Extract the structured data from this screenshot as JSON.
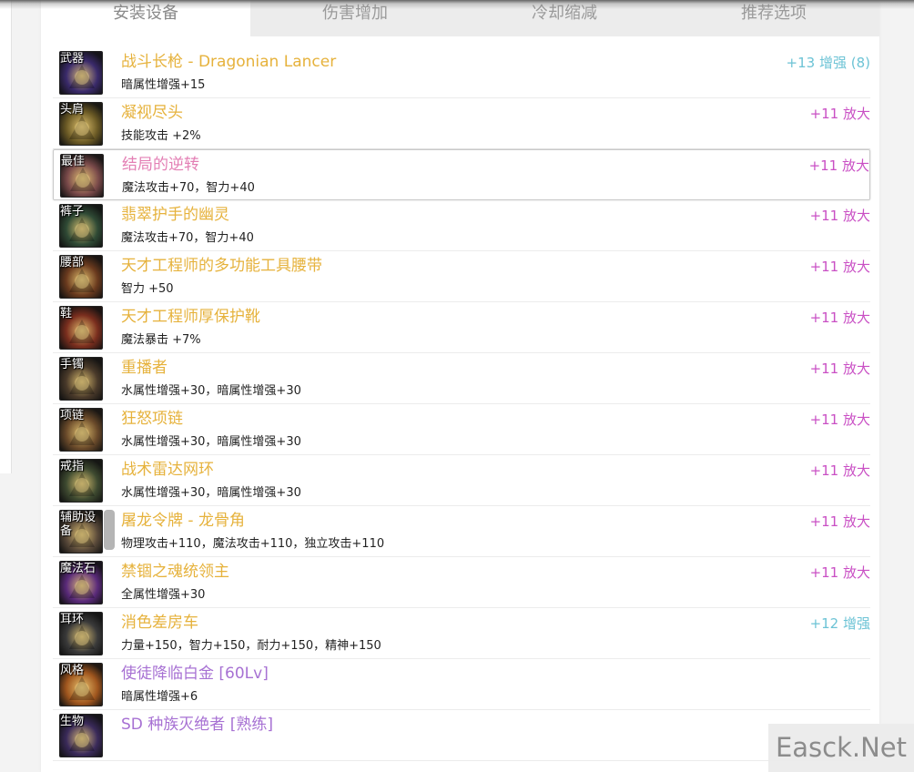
{
  "tabs": [
    {
      "label": "安装设备",
      "active": true
    },
    {
      "label": "伤害增加",
      "active": false
    },
    {
      "label": "冷却缩减",
      "active": false
    },
    {
      "label": "推荐选项",
      "active": false
    }
  ],
  "items": [
    {
      "slot": "武器",
      "name": "战斗长枪 - Dragonian Lancer",
      "stat": "暗属性增强+15",
      "enhance": "+13 增强 (8)",
      "name_color": "epic",
      "enhance_color": "cyan",
      "icon": "lance-icon",
      "bg": "#3a2a6b"
    },
    {
      "slot": "头肩",
      "name": "凝视尽头",
      "stat": "技能攻击 +2%",
      "enhance": "+11 放大",
      "name_color": "epic",
      "enhance_color": "magenta",
      "icon": "shoulder-icon",
      "bg": "#6b5a25"
    },
    {
      "slot": "最佳",
      "name": "结局的逆转",
      "stat": "魔法攻击+70，智力+40",
      "enhance": "+11 放大",
      "name_color": "pink",
      "enhance_color": "magenta",
      "icon": "top-armor-icon",
      "bg": "#7a4a4a",
      "selected": true
    },
    {
      "slot": "裤子",
      "name": "翡翠护手的幽灵",
      "stat": "魔法攻击+70，智力+40",
      "enhance": "+11 放大",
      "name_color": "epic",
      "enhance_color": "magenta",
      "icon": "pants-icon",
      "bg": "#2f4a35"
    },
    {
      "slot": "腰部",
      "name": "天才工程师的多功能工具腰带",
      "stat": "智力 +50",
      "enhance": "+11 放大",
      "name_color": "epic",
      "enhance_color": "magenta",
      "icon": "belt-icon",
      "bg": "#6a3a1e"
    },
    {
      "slot": "鞋",
      "name": "天才工程师厚保护靴",
      "stat": "魔法暴击 +7%",
      "enhance": "+11 放大",
      "name_color": "epic",
      "enhance_color": "magenta",
      "icon": "boots-icon",
      "bg": "#7a2e1e"
    },
    {
      "slot": "手镯",
      "name": "重播者",
      "stat": "水属性增强+30，暗属性增强+30",
      "enhance": "+11 放大",
      "name_color": "epic",
      "enhance_color": "magenta",
      "icon": "bracelet-icon",
      "bg": "#4a3a2a"
    },
    {
      "slot": "项链",
      "name": "狂怒项链",
      "stat": "水属性增强+30，暗属性增强+30",
      "enhance": "+11 放大",
      "name_color": "epic",
      "enhance_color": "magenta",
      "icon": "necklace-icon",
      "bg": "#6a4a2a"
    },
    {
      "slot": "戒指",
      "name": "战术雷达网环",
      "stat": "水属性增强+30，暗属性增强+30",
      "enhance": "+11 放大",
      "name_color": "epic",
      "enhance_color": "magenta",
      "icon": "ring-icon",
      "bg": "#3e4a30"
    },
    {
      "slot": "辅助设备",
      "name": "屠龙令牌 - 龙骨角",
      "stat": "物理攻击+110，魔法攻击+110，独立攻击+110",
      "enhance": "+11 放大",
      "name_color": "epic",
      "enhance_color": "magenta",
      "icon": "horn-icon",
      "bg": "#5a4a3a"
    },
    {
      "slot": "魔法石",
      "name": "禁锢之魂统领主",
      "stat": "全属性增强+30",
      "enhance": "+11 放大",
      "name_color": "epic",
      "enhance_color": "magenta",
      "icon": "magic-stone-icon",
      "bg": "#5a2a7a"
    },
    {
      "slot": "耳环",
      "name": "消色差房车",
      "stat": "力量+150，智力+150，耐力+150，精神+150",
      "enhance": "+12 增强",
      "name_color": "epic",
      "enhance_color": "cyan",
      "icon": "earring-icon",
      "bg": "#3a3a3a"
    },
    {
      "slot": "风格",
      "name": "使徒降临白金 [60Lv]",
      "stat": "暗属性增强+6",
      "enhance": "",
      "name_color": "purple",
      "enhance_color": "cyan",
      "icon": "emblem-icon",
      "bg": "#a0561e"
    },
    {
      "slot": "生物",
      "name": "SD 种族灭绝者 [熟练]",
      "stat": "",
      "enhance": "",
      "name_color": "purple",
      "enhance_color": "cyan",
      "icon": "creature-icon",
      "bg": "#3a2a5a"
    }
  ],
  "watermark": "Easck.Net"
}
